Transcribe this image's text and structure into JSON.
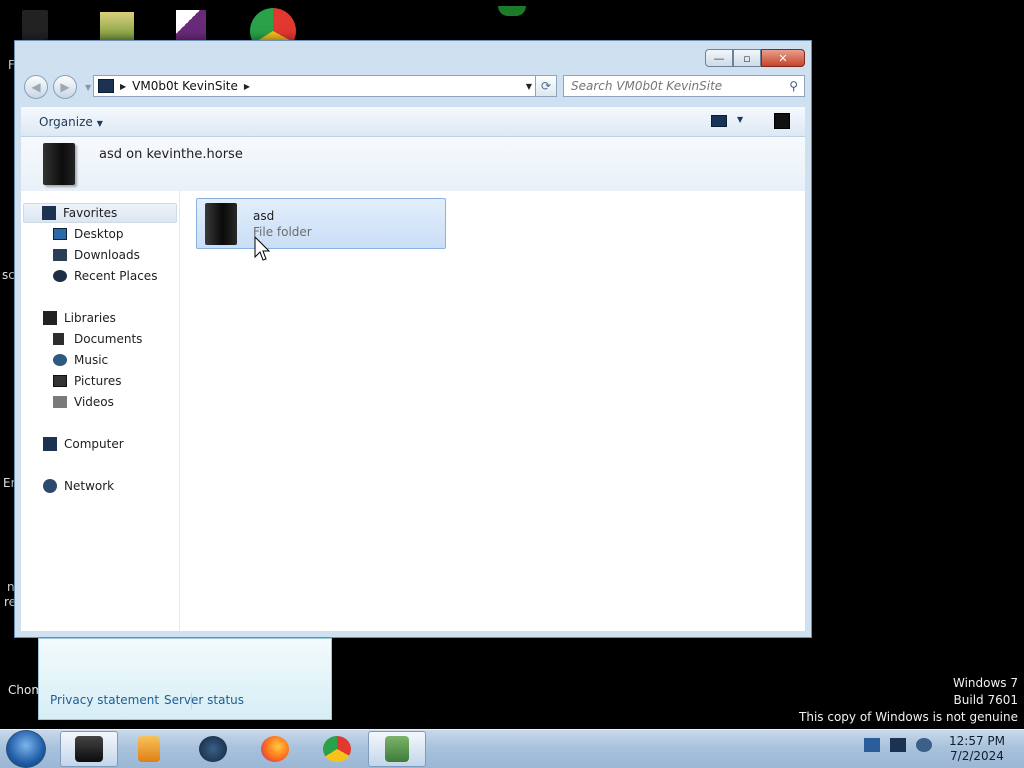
{
  "desktop": {
    "fragments": [
      "F",
      "sc",
      "Er",
      "n",
      "re",
      "Chom"
    ],
    "watermark": {
      "line1": "Windows 7",
      "line2": "Build 7601",
      "line3": "This copy of Windows is not genuine"
    }
  },
  "window": {
    "caption_buttons": {
      "minimize": "—",
      "maximize": "▫",
      "close": "✕"
    },
    "nav": {
      "back": "◀",
      "forward": "▶",
      "dropdown": "▼"
    },
    "address": {
      "segment": "VM0b0t KevinSite",
      "chevron": "▶"
    },
    "refresh": "⟳",
    "search": {
      "placeholder": "Search VM0b0t KevinSite",
      "icon": "search-icon"
    },
    "toolbar": {
      "organize": "Organize"
    },
    "header_title": "asd on kevinthe.horse",
    "nav_pane": {
      "favorites": "Favorites",
      "desktop": "Desktop",
      "downloads": "Downloads",
      "recent": "Recent Places",
      "libraries": "Libraries",
      "documents": "Documents",
      "music": "Music",
      "pictures": "Pictures",
      "videos": "Videos",
      "computer": "Computer",
      "network": "Network"
    },
    "items": [
      {
        "name": "asd",
        "type": "File folder"
      }
    ]
  },
  "popup": {
    "privacy": "Privacy statement",
    "server": "Server status"
  },
  "taskbar": {
    "time": "12:57 PM",
    "date": "7/2/2024"
  },
  "colors": {
    "selection": "#cde2f7",
    "link": "#1d5d96",
    "taskbar": "#b5cbe3"
  }
}
